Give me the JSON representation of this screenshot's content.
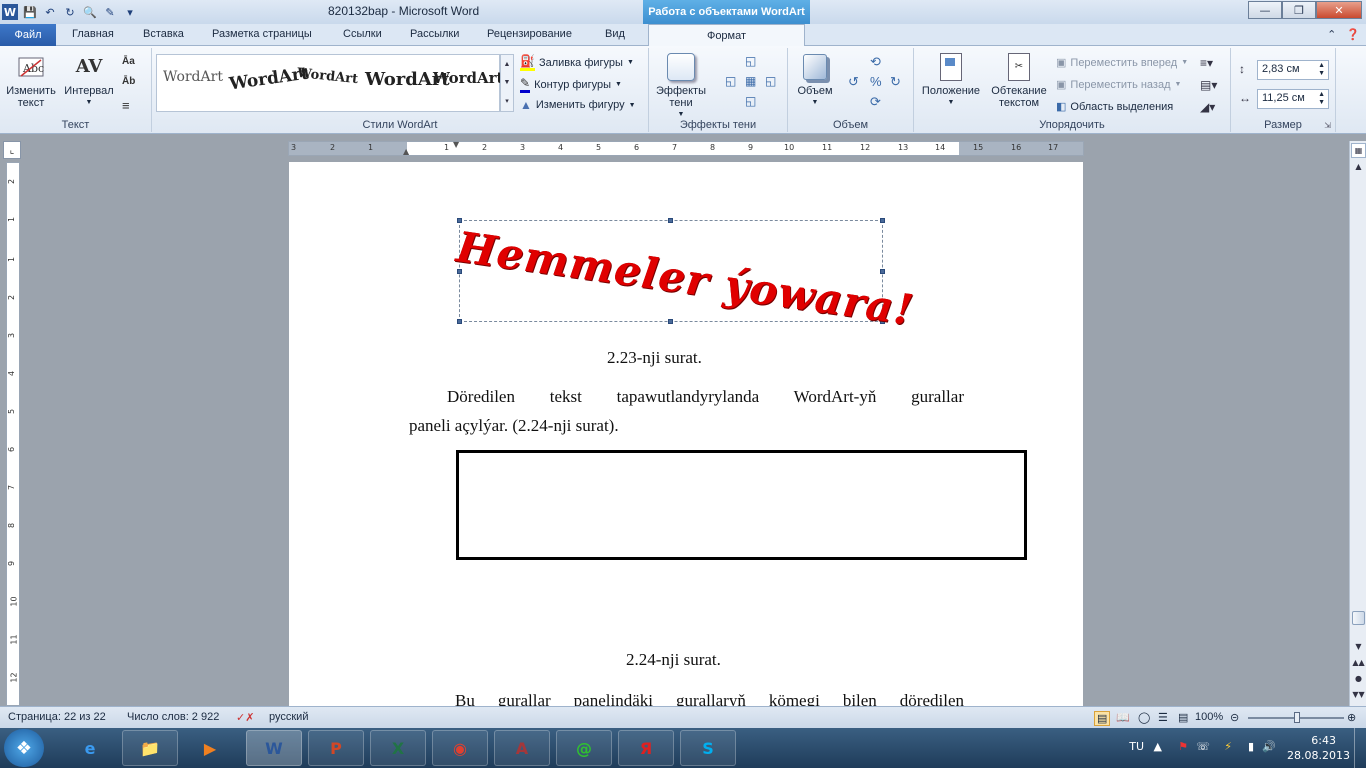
{
  "titlebar": {
    "doc_title": "820132bap - Microsoft Word",
    "context_tab": "Работа с объектами WordArt"
  },
  "tabs": {
    "file": "Файл",
    "items": [
      "Главная",
      "Вставка",
      "Разметка страницы",
      "Ссылки",
      "Рассылки",
      "Рецензирование",
      "Вид"
    ],
    "format": "Формат"
  },
  "ribbon": {
    "text_group": {
      "label": "Текст",
      "edit_text": "Изменить текст",
      "spacing": "Интервал",
      "spacing_glyph": "AV"
    },
    "styles_group": {
      "label": "Стили WordArt",
      "sample": "WordArt",
      "fill": "Заливка фигуры",
      "outline": "Контур фигуры",
      "change_shape": "Изменить фигуру"
    },
    "shadow_group": {
      "label": "Эффекты тени",
      "shadow_effects": "Эффекты тени"
    },
    "volume_group": {
      "label": "Объем",
      "volume": "Объем"
    },
    "arrange_group": {
      "label": "Упорядочить",
      "position": "Положение",
      "wrap": "Обтекание текстом",
      "bring_forward": "Переместить вперед",
      "send_backward": "Переместить назад",
      "selection_pane": "Область выделения"
    },
    "size_group": {
      "label": "Размер",
      "height": "2,83 см",
      "width": "11,25 см"
    }
  },
  "ruler": {
    "numbers": [
      "3",
      "2",
      "1",
      "1",
      "2",
      "3",
      "4",
      "5",
      "6",
      "7",
      "8",
      "9",
      "10",
      "11",
      "12",
      "13",
      "14",
      "15",
      "16",
      "17"
    ],
    "v_numbers": [
      "2",
      "1",
      "1",
      "2",
      "3",
      "4",
      "5",
      "6",
      "7",
      "8",
      "9",
      "10",
      "11",
      "12"
    ]
  },
  "document": {
    "wordart": "Hemmeler ýowara!",
    "caption1": "2.23-nji surat.",
    "para1_line1": "Döredilen tekst tapawutlandyrylanda WordArt-yň gurallar",
    "para1_line2": "paneli açylýar. (2.24-nji surat).",
    "caption2": "2.24-nji surat.",
    "para2_line1": "Bu gurallar panelindäki gurallaryň kömegi bilen döredilen"
  },
  "status": {
    "page": "Страница: 22 из 22",
    "words": "Число слов: 2 922",
    "language": "русский",
    "zoom": "100%"
  },
  "tray": {
    "lang": "TU",
    "time": "6:43",
    "date": "28.08.2013"
  }
}
